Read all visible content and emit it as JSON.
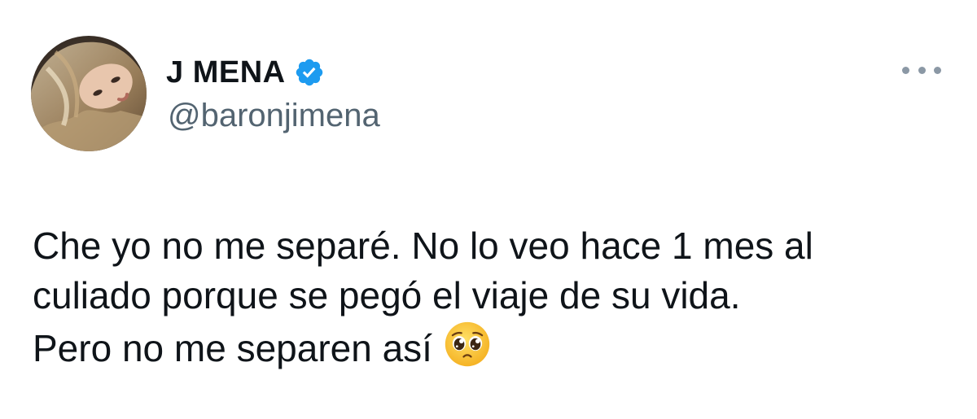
{
  "tweet": {
    "author": {
      "display_name": "J MENA",
      "handle": "@baronjimena",
      "verified": true,
      "avatar_icon": "profile-photo"
    },
    "more_icon": "more-horizontal-icon",
    "text_lines": [
      "Che yo no me separé. No lo veo hace 1 mes al",
      "culiado porque se pegó el viaje de su vida.",
      "Pero no me separen así"
    ],
    "emoji": "pleading-face-emoji"
  },
  "colors": {
    "text_primary": "#0f1419",
    "text_secondary": "#536471",
    "verified_blue": "#1d9bf0",
    "more_dots": "#8b98a5"
  }
}
